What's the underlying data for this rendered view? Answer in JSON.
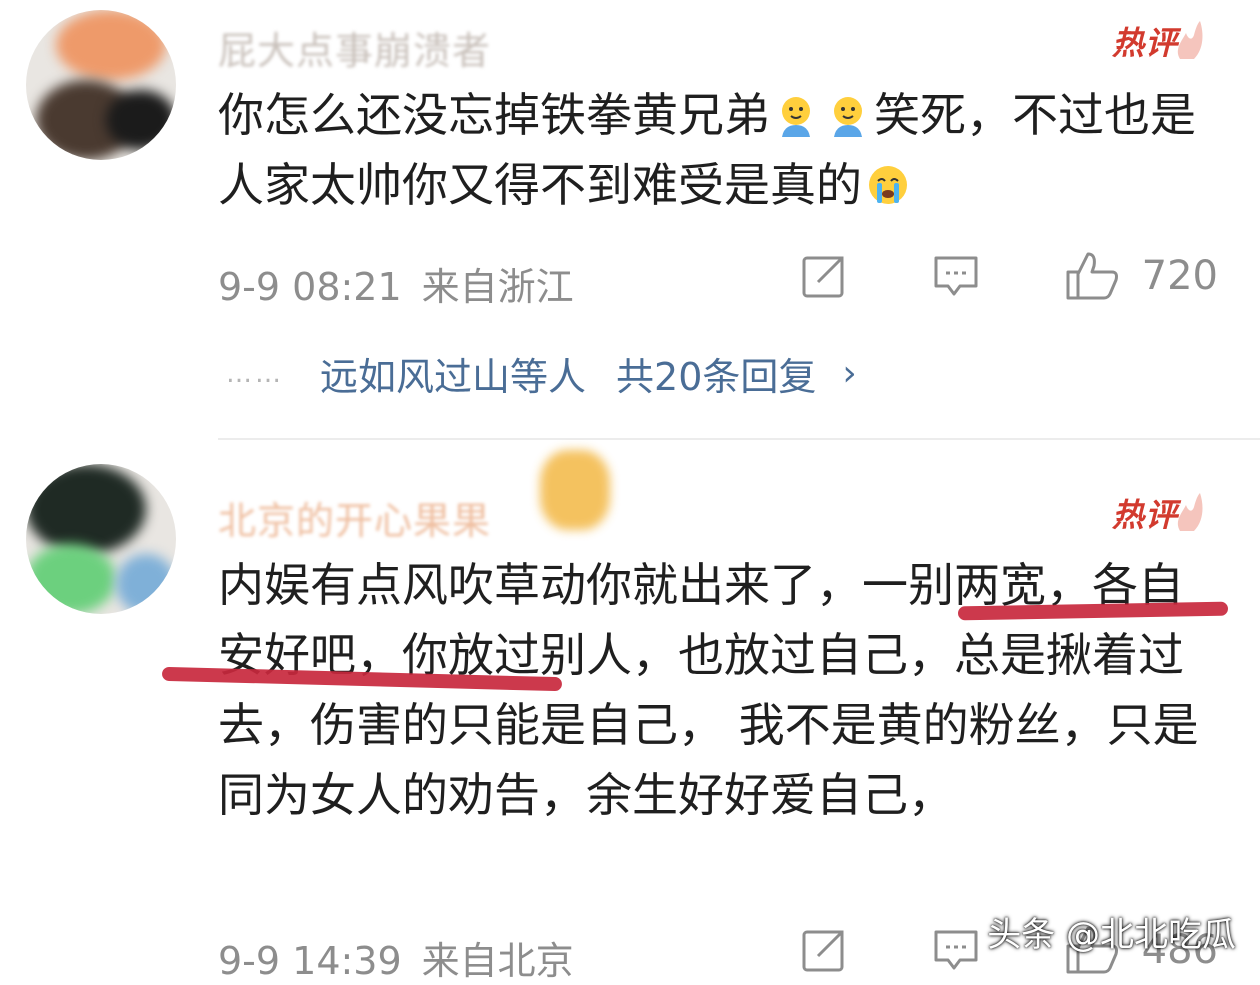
{
  "comments": [
    {
      "username": "屁大点事崩溃者",
      "badge": "热评",
      "text_before_emoji": "你怎么还没忘掉铁拳黄兄弟",
      "emojis": [
        "salute-emoji",
        "salute-emoji"
      ],
      "text_after_emoji": "笑死，不过也是人家太帅你又得不到难受是真的",
      "trailing_emoji": "crying-emoji",
      "date": "9-9 08:21",
      "location": "来自浙江",
      "likes": "720",
      "replies": {
        "dots": "……",
        "who": "远如风过山等人",
        "count": "共20条回复",
        "chevron": "›"
      }
    },
    {
      "username": "北京的开心果果",
      "badge": "热评",
      "text": "内娱有点风吹草动你就出来了，一别两宽，各自安好吧，你放过别人，也放过自己，总是揪着过去，伤害的只能是自己，  我不是黄的粉丝，只是同为女人的劝告，余生好好爱自己，",
      "date": "9-9 14:39",
      "location": "来自北京",
      "likes": "486"
    }
  ],
  "watermark": "头条 @北北吃瓜",
  "colors": {
    "hot": "#d23a2e",
    "link": "#4a6d96",
    "meta": "#8d8d8d",
    "highlight": "#c8283d"
  }
}
